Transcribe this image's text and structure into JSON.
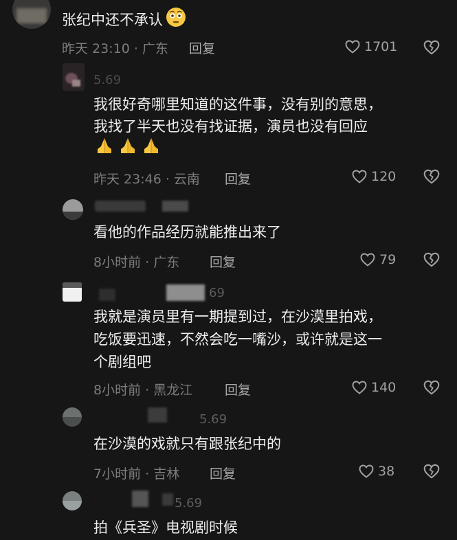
{
  "comment_top": {
    "text": "张纪中还不承认",
    "emoji": "flushed-face",
    "meta": "昨天 23:10 · 广东",
    "reply_label": "回复",
    "likes": "1701"
  },
  "replies": [
    {
      "username_fragment": "5.69",
      "lines": [
        "我很好奇哪里知道的这件事，没有别的意思，",
        "我找了半天也没有找证据，演员也没有回应"
      ],
      "emoji": "folded-hands",
      "meta": "昨天 23:46 · 云南",
      "reply_label": "回复",
      "likes": "120"
    },
    {
      "username_fragment": "",
      "lines": [
        "看他的作品经历就能推出来了"
      ],
      "meta": "8小时前 · 广东",
      "reply_label": "回复",
      "likes": "79"
    },
    {
      "username_fragment": "69",
      "lines": [
        "我就是演员里有一期提到过，在沙漠里拍戏，",
        "吃饭要迅速，不然会吃一嘴沙，或许就是这一",
        "个剧组吧"
      ],
      "meta": "8小时前 · 黑龙江",
      "reply_label": "回复",
      "likes": "140"
    },
    {
      "username_fragment": "5.69",
      "lines": [
        "在沙漠的戏就只有跟张纪中的"
      ],
      "meta": "7小时前 · 吉林",
      "reply_label": "回复",
      "likes": "38"
    },
    {
      "username_fragment": "5.69",
      "lines": [
        "拍《兵圣》电视剧时候"
      ]
    }
  ],
  "colors": {
    "background": "#161616",
    "text": "#ededed",
    "meta": "#7c7c7c",
    "icon": "#a3a3a3",
    "emoji_yellow": "#f7c842"
  }
}
